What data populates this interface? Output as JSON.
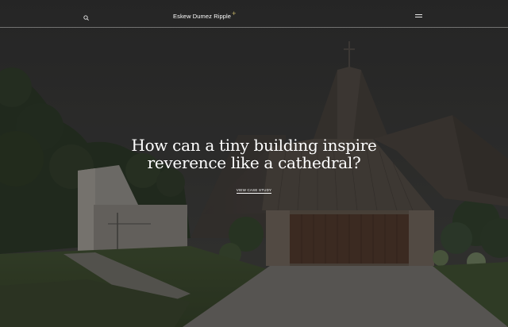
{
  "header": {
    "search_icon": "search-icon",
    "logo_text": "Eskew Dumez Ripple",
    "logo_mark": "+",
    "menu_icon": "hamburger-menu-icon"
  },
  "hero": {
    "headline_line1": "How can a tiny building inspire",
    "headline_line2": "reverence like a cathedral?",
    "cta_label": "View case study"
  },
  "colors": {
    "logo_accent": "#c9b86a",
    "text": "#ffffff"
  }
}
